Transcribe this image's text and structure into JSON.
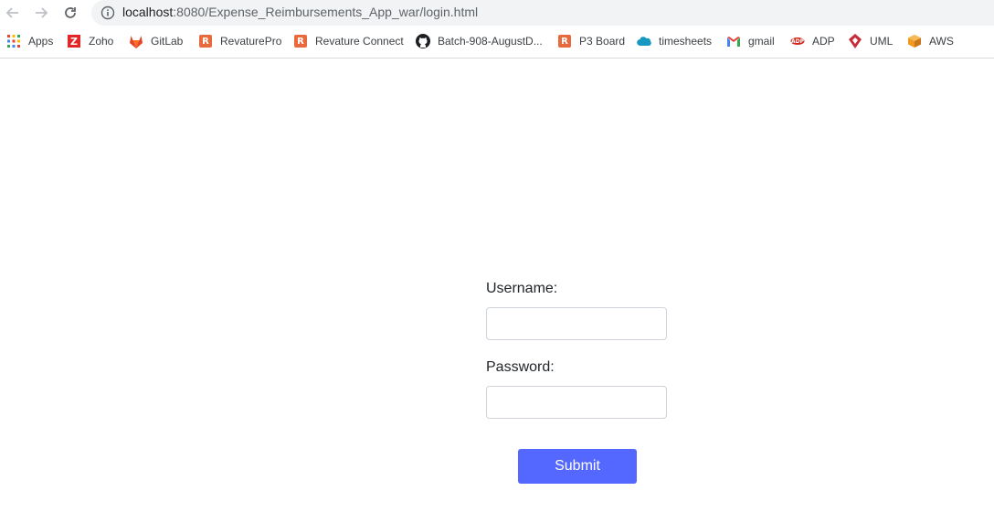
{
  "browser": {
    "url_host": "localhost",
    "url_path": ":8080/Expense_Reimbursements_App_war/login.html",
    "bookmarks": [
      {
        "label": "Apps",
        "icon": "apps-grid-icon"
      },
      {
        "label": "Zoho",
        "icon": "zoho-icon"
      },
      {
        "label": "GitLab",
        "icon": "gitlab-icon"
      },
      {
        "label": "RevaturePro",
        "icon": "revature-icon"
      },
      {
        "label": "Revature Connect",
        "icon": "revature-icon"
      },
      {
        "label": "Batch-908-AugustD...",
        "icon": "github-icon"
      },
      {
        "label": "P3 Board",
        "icon": "revature-icon"
      },
      {
        "label": "timesheets",
        "icon": "salesforce-cloud-icon"
      },
      {
        "label": "gmail",
        "icon": "gmail-icon"
      },
      {
        "label": "ADP",
        "icon": "adp-icon"
      },
      {
        "label": "UML",
        "icon": "uml-icon"
      },
      {
        "label": "AWS",
        "icon": "aws-icon"
      }
    ]
  },
  "login": {
    "username_label": "Username:",
    "username_value": "",
    "password_label": "Password:",
    "password_value": "",
    "submit_label": "Submit"
  },
  "colors": {
    "submit_bg": "#5468ff",
    "bookmark_r": "#e8693b"
  }
}
